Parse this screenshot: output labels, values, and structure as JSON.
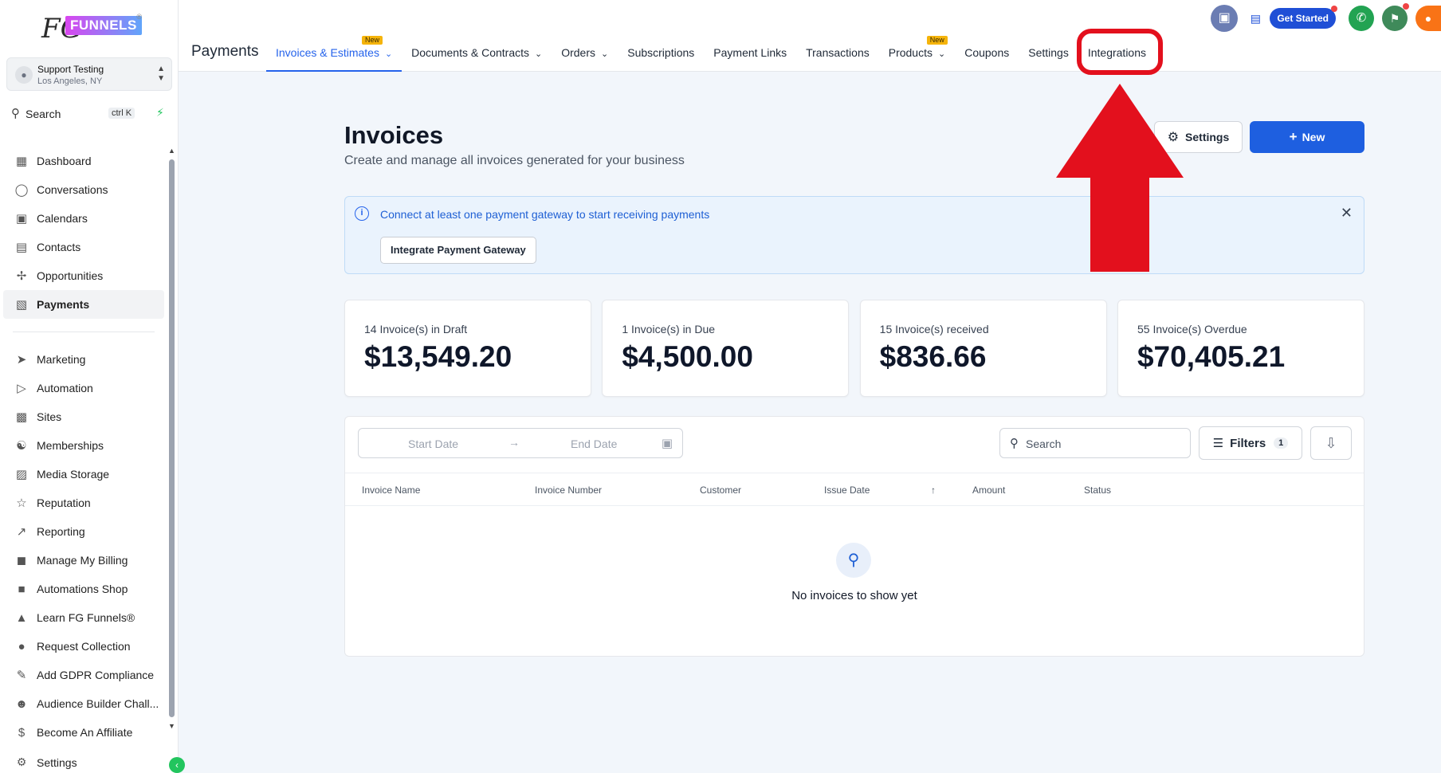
{
  "sidebar": {
    "logo": {
      "fg": "FG",
      "text": "FUNNELS",
      "reg": "®"
    },
    "account": {
      "name": "Support Testing",
      "location": "Los Angeles, NY"
    },
    "search": {
      "label": "Search",
      "shortcut": "ctrl K"
    },
    "nav_primary": [
      {
        "label": "Dashboard",
        "icon": "dashboard-icon"
      },
      {
        "label": "Conversations",
        "icon": "chat-icon"
      },
      {
        "label": "Calendars",
        "icon": "calendar-icon"
      },
      {
        "label": "Contacts",
        "icon": "contacts-icon"
      },
      {
        "label": "Opportunities",
        "icon": "opportunities-icon"
      },
      {
        "label": "Payments",
        "icon": "payments-icon",
        "active": true
      }
    ],
    "nav_secondary": [
      {
        "label": "Marketing",
        "icon": "send-icon"
      },
      {
        "label": "Automation",
        "icon": "automation-icon"
      },
      {
        "label": "Sites",
        "icon": "sites-icon"
      },
      {
        "label": "Memberships",
        "icon": "memberships-icon"
      },
      {
        "label": "Media Storage",
        "icon": "image-icon"
      },
      {
        "label": "Reputation",
        "icon": "star-icon"
      },
      {
        "label": "Reporting",
        "icon": "trend-icon"
      },
      {
        "label": "Manage My Billing",
        "icon": "billing-icon"
      },
      {
        "label": "Automations Shop",
        "icon": "cart-icon"
      },
      {
        "label": "Learn FG Funnels®",
        "icon": "graduation-icon"
      },
      {
        "label": "Request Collection",
        "icon": "trophy-icon"
      },
      {
        "label": "Add GDPR Compliance",
        "icon": "edit-doc-icon"
      },
      {
        "label": "Audience Builder Chall...",
        "icon": "people-icon"
      },
      {
        "label": "Become An Affiliate",
        "icon": "dollar-icon"
      }
    ],
    "settings_label": "Settings"
  },
  "topbar": {
    "page_label": "Payments",
    "get_started": "Get Started",
    "tabs": [
      {
        "label": "Invoices & Estimates",
        "active": true,
        "dropdown": true,
        "badge": "New"
      },
      {
        "label": "Documents & Contracts",
        "dropdown": true
      },
      {
        "label": "Orders",
        "dropdown": true
      },
      {
        "label": "Subscriptions"
      },
      {
        "label": "Payment Links"
      },
      {
        "label": "Transactions"
      },
      {
        "label": "Products",
        "dropdown": true,
        "badge": "New"
      },
      {
        "label": "Coupons"
      },
      {
        "label": "Settings"
      },
      {
        "label": "Integrations",
        "highlighted": true
      }
    ]
  },
  "main": {
    "title": "Invoices",
    "subtitle": "Create and manage all invoices generated for your business",
    "settings_button": "Settings",
    "new_button": "New",
    "alert": {
      "text": "Connect at least one payment gateway to start receiving payments",
      "button": "Integrate Payment Gateway"
    },
    "stats": [
      {
        "label": "14 Invoice(s) in Draft",
        "value": "$13,549.20"
      },
      {
        "label": "1 Invoice(s) in Due",
        "value": "$4,500.00"
      },
      {
        "label": "15 Invoice(s) received",
        "value": "$836.66"
      },
      {
        "label": "55 Invoice(s) Overdue",
        "value": "$70,405.21"
      }
    ],
    "table": {
      "start_date_placeholder": "Start Date",
      "end_date_placeholder": "End Date",
      "search_placeholder": "Search",
      "filters_label": "Filters",
      "filters_count": "1",
      "columns": [
        "Invoice Name",
        "Invoice Number",
        "Customer",
        "Issue Date",
        "Amount",
        "Status"
      ],
      "empty_text": "No invoices to show yet"
    }
  },
  "colors": {
    "accent": "#1e5fe0",
    "highlight": "#e3101d",
    "badge": "#f5b40b"
  }
}
